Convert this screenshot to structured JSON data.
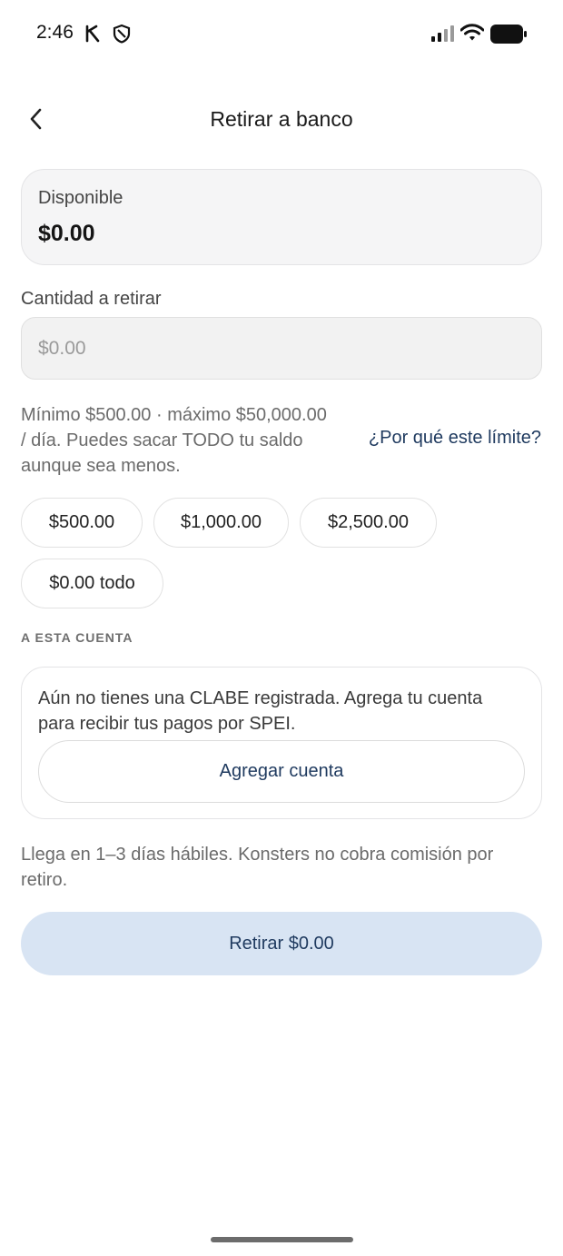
{
  "status_bar": {
    "time": "2:46",
    "icons": [
      "k-icon",
      "shield-icon",
      "signal-icon",
      "wifi-icon",
      "battery-icon"
    ]
  },
  "header": {
    "title": "Retirar a banco",
    "back_icon": "chevron-left-icon"
  },
  "available": {
    "label": "Disponible",
    "value": "$0.00"
  },
  "amount": {
    "label": "Cantidad a retirar",
    "placeholder": "$0.00"
  },
  "limits": {
    "text": "Mínimo $500.00 · máximo $50,000.00 / día. Puedes sacar TODO tu saldo aunque sea menos.",
    "link": "¿Por qué este límite?"
  },
  "quick_amounts": [
    {
      "label": "$500.00"
    },
    {
      "label": "$1,000.00"
    },
    {
      "label": "$2,500.00"
    },
    {
      "label": "$0.00 todo"
    }
  ],
  "account_section": {
    "label": "A ESTA CUENTA",
    "empty_message": "Aún no tienes una CLABE registrada. Agrega tu cuenta para recibir tus pagos por SPEI.",
    "add_button": "Agregar cuenta"
  },
  "info": {
    "text": "Llega en 1–3 días hábiles. Konsters no cobra comisión por retiro."
  },
  "submit": {
    "label": "Retirar $0.00"
  },
  "colors": {
    "accent": "#1f3a5f",
    "button_bg": "#d8e4f3",
    "card_bg": "#f5f5f6"
  }
}
